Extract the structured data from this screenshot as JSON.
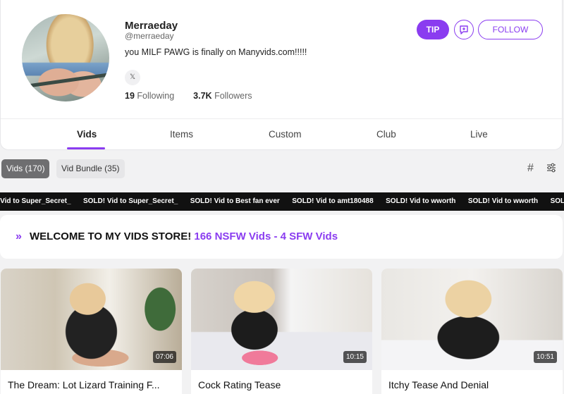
{
  "profile": {
    "name": "Merraeday",
    "handle": "@merraeday",
    "bio": "you MILF PAWG is finally on Manyvids.com!!!!!",
    "social_icon": "x-icon",
    "social_label": "X",
    "following_count": "19",
    "following_label": "Following",
    "followers_count": "3.7K",
    "followers_label": "Followers"
  },
  "actions": {
    "tip_label": "TIP",
    "message_icon": "chat-plus-icon",
    "follow_label": "FOLLOW"
  },
  "tabs": [
    {
      "label": "Vids",
      "active": true
    },
    {
      "label": "Items",
      "active": false
    },
    {
      "label": "Custom",
      "active": false
    },
    {
      "label": "Club",
      "active": false
    },
    {
      "label": "Live",
      "active": false
    }
  ],
  "filters": {
    "chips": [
      {
        "label": "Vids (170)",
        "active": true
      },
      {
        "label": "Vid Bundle (35)",
        "active": false
      }
    ],
    "hash_icon": "#",
    "filter_icon": "sliders-icon"
  },
  "ticker": [
    "! Vid to Super_Secret_",
    "SOLD! Vid to Super_Secret_",
    "SOLD! Vid to Best fan ever",
    "SOLD! Vid to amt180488",
    "SOLD! Vid to wworth",
    "SOLD! Vid to wworth",
    "SOLD! Vid to"
  ],
  "welcome": {
    "chevrons": "»",
    "text": "WELCOME TO MY VIDS STORE!",
    "accent": "166 NSFW Vids - 4 SFW Vids"
  },
  "videos": [
    {
      "title": "The Dream: Lot Lizard Training F...",
      "duration": "07:06"
    },
    {
      "title": "Cock Rating Tease",
      "duration": "10:15"
    },
    {
      "title": "Itchy Tease And Denial",
      "duration": "10:51"
    }
  ],
  "colors": {
    "accent": "#8a3cf0",
    "ticker_bg": "#111111"
  }
}
